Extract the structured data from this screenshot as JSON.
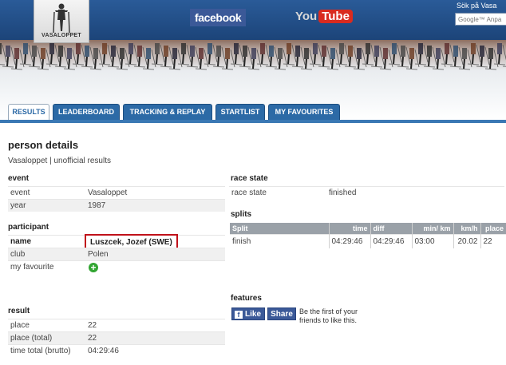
{
  "header": {
    "logo_text": "VASALOPPET",
    "facebook_label": "facebook",
    "youtube_you": "You",
    "youtube_tube": "Tube",
    "search_label": "Sök på Vasa",
    "search_placeholder": "Google™ Anpa"
  },
  "tabs": [
    {
      "label": "RESULTS",
      "active": true
    },
    {
      "label": "LEADERBOARD"
    },
    {
      "label": "TRACKING & REPLAY"
    },
    {
      "label": "STARTLIST"
    },
    {
      "label": "MY FAVOURITES"
    }
  ],
  "page": {
    "title": "person details",
    "subtitle": "Vasaloppet | unofficial results"
  },
  "event": {
    "heading": "event",
    "rows": [
      {
        "k": "event",
        "v": "Vasaloppet"
      },
      {
        "k": "year",
        "v": "1987"
      }
    ]
  },
  "participant": {
    "heading": "participant",
    "name_key": "name",
    "name_value": "Luszcek, Jozef (SWE)",
    "club_key": "club",
    "club_value": "Polen",
    "fav_key": "my favourite"
  },
  "result": {
    "heading": "result",
    "rows": [
      {
        "k": "place",
        "v": "22"
      },
      {
        "k": "place (total)",
        "v": "22"
      },
      {
        "k": "time total (brutto)",
        "v": "04:29:46"
      }
    ]
  },
  "race_state": {
    "heading": "race state",
    "key": "race state",
    "value": "finished"
  },
  "splits": {
    "heading": "splits",
    "headers": [
      "Split",
      "time",
      "diff",
      "min/ km",
      "km/h",
      "place"
    ],
    "row": [
      "finish",
      "04:29:46",
      "04:29:46",
      "03:00",
      "20.02",
      "22"
    ]
  },
  "features": {
    "heading": "features",
    "like_label": "Like",
    "share_label": "Share",
    "text": "Be the first of your friends to like this."
  },
  "colors": {
    "tab_blue": "#2c6aa6",
    "header_blue": "#1c4479",
    "highlight_red": "#c0111a",
    "facebook_blue": "#3b5998",
    "favourite_green": "#32a532"
  }
}
